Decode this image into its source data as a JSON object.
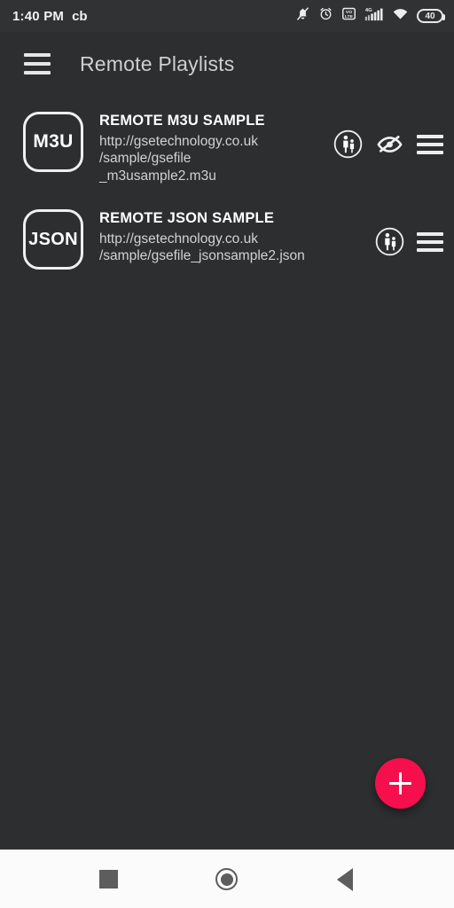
{
  "status_bar": {
    "time": "1:40 PM",
    "carrier": "cb",
    "icons": [
      "bell-muted-icon",
      "alarm-clock-icon",
      "volte-icon",
      "signal-4g-icon",
      "wifi-icon"
    ],
    "battery_level": "40"
  },
  "app_bar": {
    "menu_icon": "hamburger-menu-icon",
    "title": "Remote Playlists"
  },
  "playlists": [
    {
      "badge": "M3U",
      "title": "REMOTE M3U SAMPLE",
      "url": "http://gsetechnology.co.uk\n/sample/gsefile\n_m3usample2.m3u",
      "actions": [
        "parental-control-icon",
        "visibility-off-icon",
        "overflow-list-icon"
      ]
    },
    {
      "badge": "JSON",
      "title": "REMOTE JSON SAMPLE",
      "url": "http://gsetechnology.co.uk\n/sample/gsefile_jsonsample2.json",
      "actions": [
        "parental-control-icon",
        "overflow-list-icon"
      ]
    }
  ],
  "fab": {
    "icon": "plus-icon",
    "color": "#f50f4d"
  },
  "nav_bar": {
    "recents": "square-recents-icon",
    "home": "circle-home-icon",
    "back": "triangle-back-icon"
  },
  "colors": {
    "background": "#2c2e30",
    "status_bar": "#303234",
    "accent": "#f50f4d",
    "text_primary": "#ffffff",
    "text_secondary": "#d2d2d2",
    "nav_bar": "#fbfbfb"
  }
}
